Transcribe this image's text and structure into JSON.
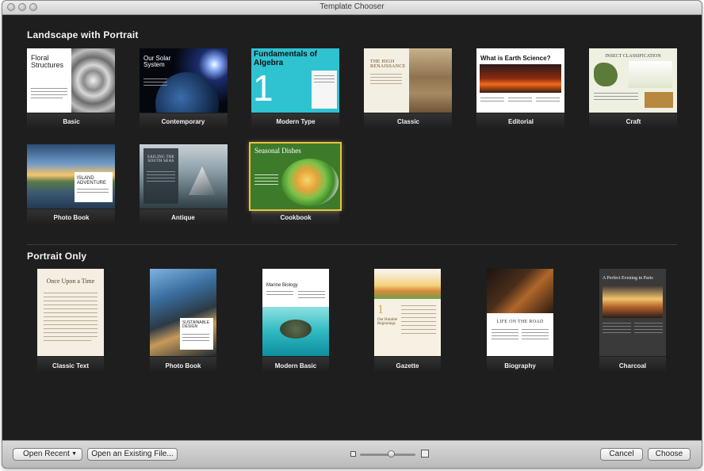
{
  "window": {
    "title": "Template Chooser"
  },
  "sections": {
    "landscape": "Landscape with Portrait",
    "portrait": "Portrait Only"
  },
  "landscape_templates": [
    {
      "label": "Basic",
      "heading": "Floral Structures"
    },
    {
      "label": "Contemporary",
      "heading": "Our Solar System"
    },
    {
      "label": "Modern Type",
      "heading": "Fundamentals of Algebra",
      "number": "1"
    },
    {
      "label": "Classic",
      "heading": "THE HIGH RENAISSANCE"
    },
    {
      "label": "Editorial",
      "heading": "What is Earth Science?"
    },
    {
      "label": "Craft",
      "heading": "INSECT CLASSIFICATION"
    },
    {
      "label": "Photo Book",
      "heading": "ISLAND ADVENTURE"
    },
    {
      "label": "Antique",
      "heading": "SAILING THE SOUTH SEAS"
    },
    {
      "label": "Cookbook",
      "heading": "Seasonal Dishes"
    }
  ],
  "portrait_templates": [
    {
      "label": "Classic Text",
      "heading": "Once Upon a Time"
    },
    {
      "label": "Photo Book",
      "heading": "SUSTAINABLE DESIGN"
    },
    {
      "label": "Modern Basic",
      "heading": "Marine Biology"
    },
    {
      "label": "Gazette",
      "heading": "Our Humble Beginnings",
      "number": "1"
    },
    {
      "label": "Biography",
      "heading": "LIFE ON THE ROAD"
    },
    {
      "label": "Charcoal",
      "heading": "A Perfect Evening in Paris"
    }
  ],
  "toolbar": {
    "open_recent": "Open Recent",
    "open_existing": "Open an Existing File...",
    "cancel": "Cancel",
    "choose": "Choose"
  },
  "zoom": {
    "level": 0.55
  },
  "selected_template": "Cookbook",
  "colors": {
    "accent_selection": "#e4c24a",
    "window_bg": "#1e1e1e"
  }
}
